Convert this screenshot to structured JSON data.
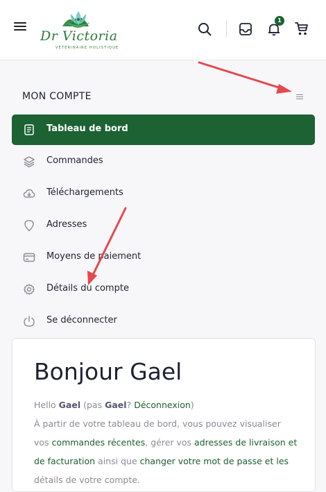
{
  "header": {
    "logo_text": "Dr Victoria",
    "logo_subtitle": "VÉTÉRINAIRE HOLISTIQUE",
    "notification_count": "1"
  },
  "account": {
    "title": "MON COMPTE",
    "nav": [
      {
        "label": "Tableau de bord",
        "icon": "dashboard-icon",
        "active": true
      },
      {
        "label": "Commandes",
        "icon": "layers-icon"
      },
      {
        "label": "Téléchargements",
        "icon": "cloud-download-icon"
      },
      {
        "label": "Adresses",
        "icon": "map-pin-icon"
      },
      {
        "label": "Moyens de paiement",
        "icon": "credit-card-icon"
      },
      {
        "label": "Détails du compte",
        "icon": "gear-icon"
      },
      {
        "label": "Se déconnecter",
        "icon": "power-icon"
      }
    ]
  },
  "dashboard": {
    "greeting": "Bonjour Gael",
    "hello": "Hello",
    "user": "Gael",
    "not_prefix": "(pas",
    "not_user": "Gael",
    "qmark": "?",
    "logout_link": "Déconnexion",
    "close_paren": ")",
    "text1": "À partir de votre tableau de bord, vous pouvez visualiser vos",
    "link_orders": "commandes récentes",
    "text2": ", gérer vos",
    "link_addresses": "adresses de livraison et de facturation",
    "text3": "ainsi que",
    "link_password": "changer votre mot de passe et les",
    "text4": "détails de votre compte."
  },
  "colors": {
    "brand_green": "#1c6233",
    "annotation_arrow": "#e5484d"
  }
}
